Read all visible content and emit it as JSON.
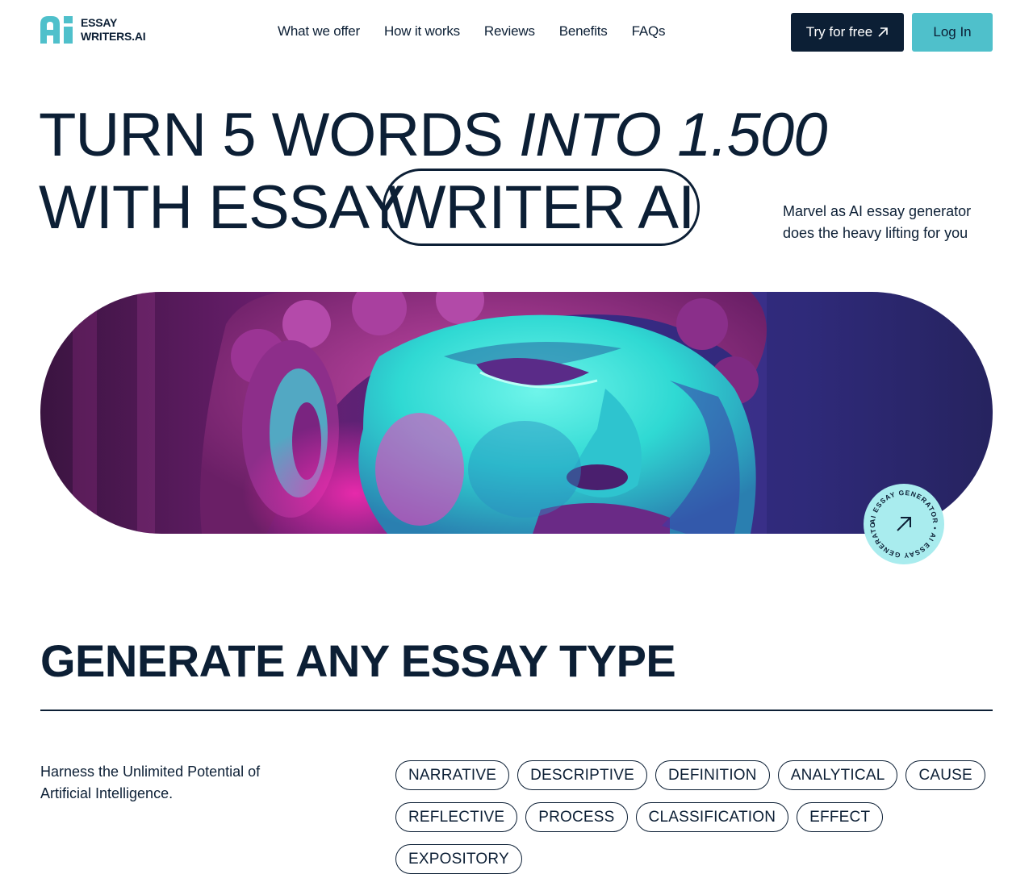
{
  "header": {
    "logo": {
      "line1": "ESSAY",
      "line2": "WRITERS.AI"
    },
    "nav": [
      {
        "label": "What we offer"
      },
      {
        "label": "How it works"
      },
      {
        "label": "Reviews"
      },
      {
        "label": "Benefits"
      },
      {
        "label": "FAQs"
      }
    ],
    "try_label": "Try for free",
    "login_label": "Log In"
  },
  "hero": {
    "line1_a": "TURN 5 WORDS ",
    "line1_b": "INTO 1.500",
    "line2": "WITH ESSAY",
    "pill": "WRITER AI",
    "subtitle": "Marvel as AI essay generator does the heavy lifting for you"
  },
  "badge": {
    "text": "AI ESSAY GENERATOR • AI ESSAY GENERATOR •"
  },
  "essay_types": {
    "title": "GENERATE ANY ESSAY TYPE",
    "subtitle": "Harness the Unlimited Potential of Artificial Intelligence.",
    "tags": [
      "NARRATIVE",
      "DESCRIPTIVE",
      "DEFINITION",
      "ANALYTICAL",
      "CAUSE",
      "REFLECTIVE",
      "PROCESS",
      "CLASSIFICATION",
      "EFFECT",
      "EXPOSITORY"
    ]
  },
  "colors": {
    "navy": "#0c1f35",
    "teal": "#4fc0cb",
    "badge": "#a9ecee",
    "magenta": "#e0249a",
    "cyan": "#3fe6dc",
    "indigo": "#3b2a8a"
  }
}
